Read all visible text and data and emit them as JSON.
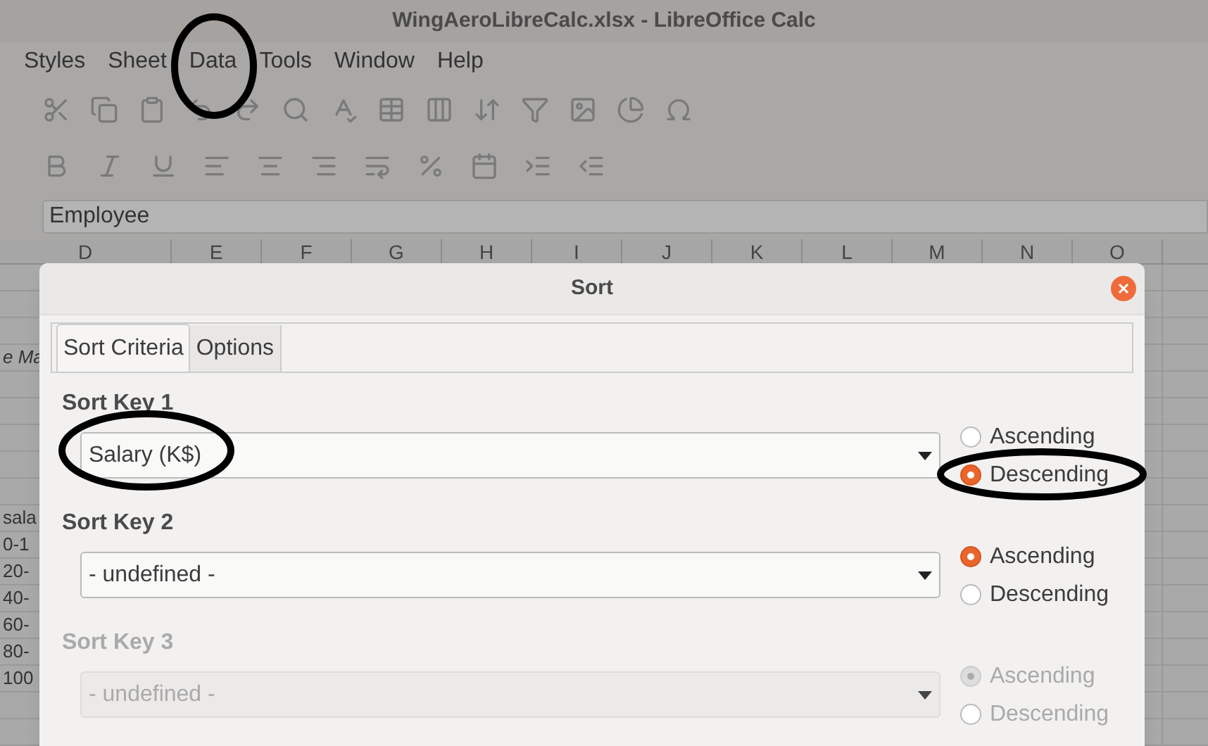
{
  "window": {
    "title": "WingAeroLibreCalc.xlsx - LibreOffice Calc"
  },
  "menu": [
    "Styles",
    "Sheet",
    "Data",
    "Tools",
    "Window",
    "Help"
  ],
  "formula_bar": {
    "value": "Employee"
  },
  "columns": [
    "D",
    "E",
    "F",
    "G",
    "H",
    "I",
    "J",
    "K",
    "L",
    "M",
    "N",
    "O"
  ],
  "left_cells": {
    "note": "e Ma",
    "labels": [
      "sala",
      "0-1",
      "20-",
      "40-",
      "60-",
      "80-",
      "100"
    ]
  },
  "dialog": {
    "title": "Sort",
    "tabs": [
      {
        "label": "Sort Criteria",
        "selected": true
      },
      {
        "label": "Options",
        "selected": false
      }
    ],
    "sort_keys": [
      {
        "label": "Sort Key 1",
        "value": "Salary (K$)",
        "disabled": false,
        "options": [
          {
            "label": "Ascending",
            "selected": false
          },
          {
            "label": "Descending",
            "selected": true
          }
        ]
      },
      {
        "label": "Sort Key 2",
        "value": "- undefined -",
        "disabled": false,
        "options": [
          {
            "label": "Ascending",
            "selected": true
          },
          {
            "label": "Descending",
            "selected": false
          }
        ]
      },
      {
        "label": "Sort Key 3",
        "value": "- undefined -",
        "disabled": true,
        "options": [
          {
            "label": "Ascending",
            "selected": true
          },
          {
            "label": "Descending",
            "selected": false
          }
        ]
      }
    ]
  }
}
